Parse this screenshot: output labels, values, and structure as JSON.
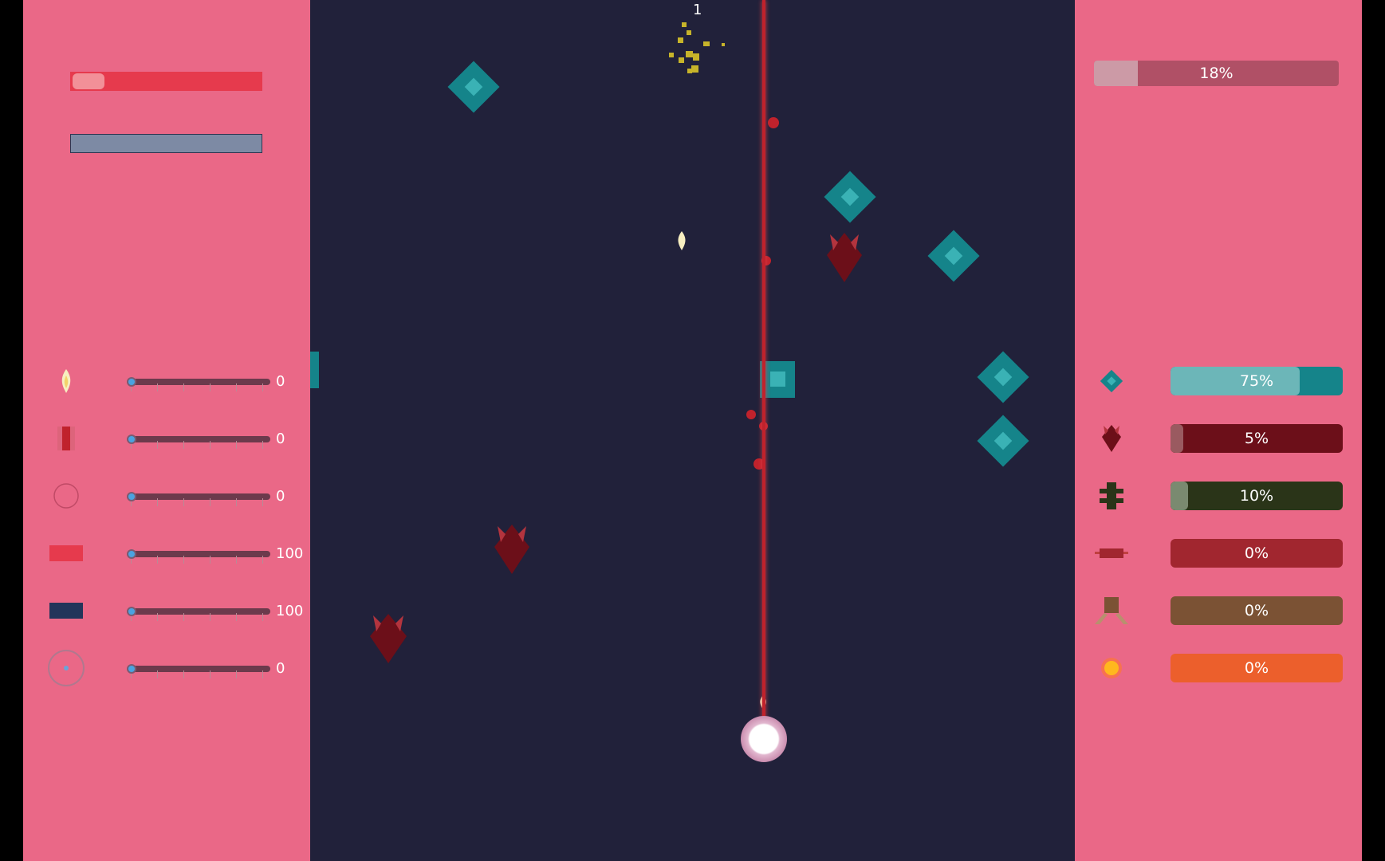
{
  "hud": {
    "wave_counter": "1",
    "health_bar": {
      "fill_fraction": 0.17
    },
    "shield_bar": {
      "fill_fraction": 1.0
    }
  },
  "upgrades": [
    {
      "icon": "flame-bullet-icon",
      "value": "0",
      "slider_level": 0
    },
    {
      "icon": "laser-icon",
      "value": "0",
      "slider_level": 0
    },
    {
      "icon": "ring-icon",
      "value": "0",
      "slider_level": 0
    },
    {
      "icon": "health-block-icon",
      "value": "100",
      "slider_level": 0
    },
    {
      "icon": "shield-block-icon",
      "value": "100",
      "slider_level": 0
    },
    {
      "icon": "target-orb-icon",
      "value": "0",
      "slider_level": 0
    }
  ],
  "progress": {
    "label": "18%",
    "fraction": 0.18
  },
  "enemies": [
    {
      "icon": "teal-diamond-icon",
      "label": "75%",
      "fraction": 0.75,
      "track_color": "#15848a",
      "fill_color": "#6cb6b8"
    },
    {
      "icon": "red-bat-icon",
      "label": "5%",
      "fraction": 0.05,
      "track_color": "#6c0f19",
      "fill_color": "#9a5a60"
    },
    {
      "icon": "green-bug-icon",
      "label": "10%",
      "fraction": 0.1,
      "track_color": "#2a3418",
      "fill_color": "#7a8a70"
    },
    {
      "icon": "red-bar-icon",
      "label": "0%",
      "fraction": 0,
      "track_color": "#a1262f",
      "fill_color": "#a1262f"
    },
    {
      "icon": "brown-turret-icon",
      "label": "0%",
      "fraction": 0,
      "track_color": "#7b5234",
      "fill_color": "#7b5234"
    },
    {
      "icon": "orange-orb-icon",
      "label": "0%",
      "fraction": 0,
      "track_color": "#ec5f2c",
      "fill_color": "#ec5f2c"
    }
  ],
  "colors": {
    "panel": "#ea6887",
    "playfield": "#21213a",
    "teal": "#15848a",
    "laser": "#c0222c"
  }
}
